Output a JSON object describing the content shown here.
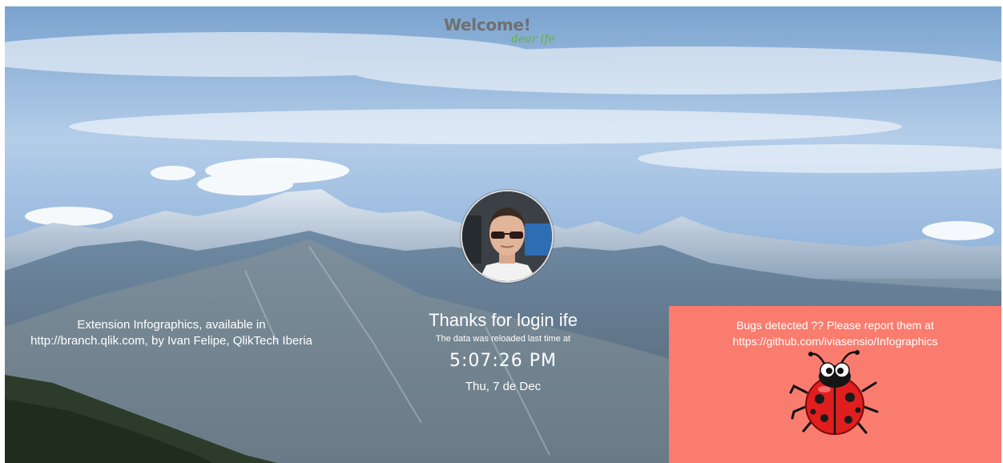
{
  "header": {
    "title": "Welcome!",
    "subtitle": "dear ife"
  },
  "center": {
    "thanks": "Thanks for login ife",
    "reload_note": "The data was reloaded last time at",
    "time": "5:07:26 PM",
    "date": "Thu, 7 de Dec"
  },
  "left_info": {
    "line1": "Extension Infographics, available in",
    "line2": "http://branch.qlik.com, by Ivan Felipe, QlikTech Iberia"
  },
  "bug_panel": {
    "line1": "Bugs detected ?? Please report them at",
    "line2": "https://github.com/iviasensio/Infographics",
    "bg_color": "#fa7c6e"
  },
  "colors": {
    "welcome_text": "#707070",
    "subtitle_text": "#63b32e"
  },
  "images": {
    "background": "mountain-landscape",
    "avatar": "user-avatar",
    "mascot": "ladybug-icon"
  }
}
